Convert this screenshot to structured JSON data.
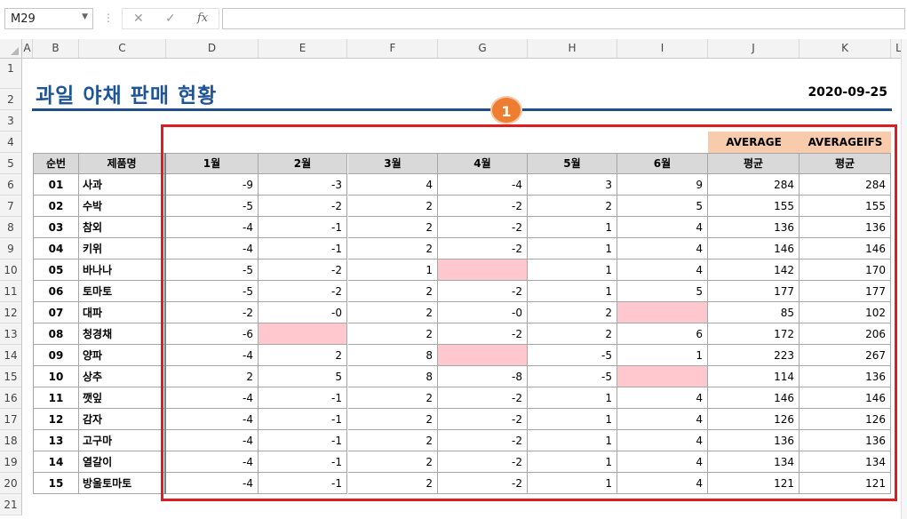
{
  "formula_bar": {
    "name_box": "M29",
    "dots": "⋮",
    "cancel_icon": "✕",
    "enter_icon": "✓",
    "fx_label": "fx",
    "formula": ""
  },
  "columns": [
    "A",
    "B",
    "C",
    "D",
    "E",
    "F",
    "G",
    "H",
    "I",
    "J",
    "K",
    "L"
  ],
  "rows": [
    "1",
    "2",
    "3",
    "4",
    "5",
    "6",
    "7",
    "8",
    "9",
    "10",
    "11",
    "12",
    "13",
    "14",
    "15",
    "16",
    "17",
    "18",
    "19",
    "20",
    "21"
  ],
  "sheet": {
    "title": "과일 야채 판매 현황",
    "date": "2020-09-25",
    "badge": "1",
    "func_headers": [
      "AVERAGE",
      "AVERAGEIFS"
    ],
    "headers": [
      "순번",
      "제품명",
      "1월",
      "2월",
      "3월",
      "4월",
      "5월",
      "6월",
      "평균",
      "평균"
    ],
    "data": [
      [
        "01",
        "사과",
        "-9",
        "-3",
        "4",
        "-4",
        "3",
        "9",
        "284",
        "284"
      ],
      [
        "02",
        "수박",
        "-5",
        "-2",
        "2",
        "-2",
        "2",
        "5",
        "155",
        "155"
      ],
      [
        "03",
        "참외",
        "-4",
        "-1",
        "2",
        "-2",
        "1",
        "4",
        "136",
        "136"
      ],
      [
        "04",
        "키위",
        "-4",
        "-1",
        "2",
        "-2",
        "1",
        "4",
        "146",
        "146"
      ],
      [
        "05",
        "바나나",
        "-5",
        "-2",
        "1",
        "",
        "1",
        "4",
        "142",
        "170"
      ],
      [
        "06",
        "토마토",
        "-5",
        "-2",
        "2",
        "-2",
        "1",
        "5",
        "177",
        "177"
      ],
      [
        "07",
        "대파",
        "-2",
        "-0",
        "2",
        "-0",
        "2",
        "",
        "85",
        "102"
      ],
      [
        "08",
        "청경채",
        "-6",
        "",
        "2",
        "-2",
        "2",
        "6",
        "172",
        "206"
      ],
      [
        "09",
        "양파",
        "-4",
        "2",
        "8",
        "",
        "-5",
        "1",
        "223",
        "267"
      ],
      [
        "10",
        "상추",
        "2",
        "5",
        "8",
        "-8",
        "-5",
        "",
        "114",
        "136"
      ],
      [
        "11",
        "깻잎",
        "-4",
        "-1",
        "2",
        "-2",
        "1",
        "4",
        "146",
        "146"
      ],
      [
        "12",
        "감자",
        "-4",
        "-1",
        "2",
        "-2",
        "1",
        "4",
        "126",
        "126"
      ],
      [
        "13",
        "고구마",
        "-4",
        "-1",
        "2",
        "-2",
        "1",
        "4",
        "136",
        "136"
      ],
      [
        "14",
        "열갈이",
        "-4",
        "-1",
        "2",
        "-2",
        "1",
        "4",
        "134",
        "134"
      ],
      [
        "15",
        "방울토마토",
        "-4",
        "-1",
        "2",
        "-2",
        "1",
        "4",
        "121",
        "121"
      ]
    ],
    "highlight_color": "#ffc7ce",
    "header_fill": "#d9d9d9",
    "func_header_fill": "#f8cbad",
    "title_color": "#1f5597",
    "frame_color": "#e01b22"
  }
}
